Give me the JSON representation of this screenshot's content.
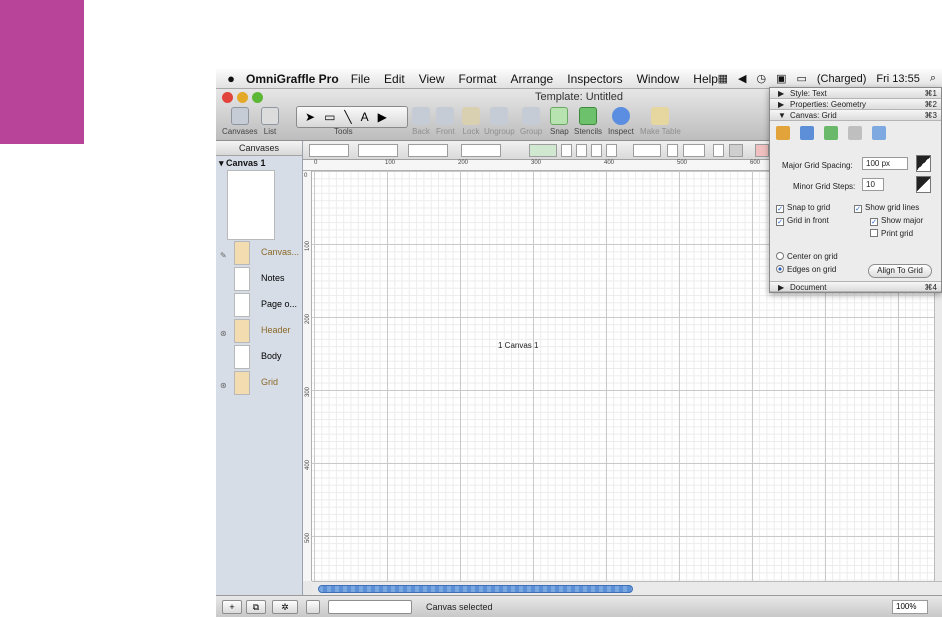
{
  "menubar": {
    "app_name": "OmniGraffle Pro",
    "items": [
      "File",
      "Edit",
      "View",
      "Format",
      "Arrange",
      "Inspectors",
      "Window",
      "Help"
    ],
    "battery": "(Charged)",
    "clock": "Fri 13:55"
  },
  "window": {
    "title": "Template: Untitled"
  },
  "toolbar": {
    "canvases_label": "Canvases",
    "list_label": "List",
    "tools_label": "Tools",
    "buttons": [
      "Back",
      "Front",
      "Lock",
      "Ungroup",
      "Group",
      "Snap",
      "Stencils",
      "Inspect",
      "Make Table"
    ]
  },
  "sidebar": {
    "header": "Canvases",
    "canvas_name": "▾ Canvas 1",
    "layers": [
      "Canvas...",
      "Notes",
      "Page o...",
      "Header",
      "Body",
      "Grid"
    ]
  },
  "ruler": {
    "top": [
      "0",
      "100",
      "200",
      "300",
      "400",
      "500",
      "600"
    ],
    "left": [
      "0",
      "100",
      "200",
      "300",
      "400",
      "500"
    ]
  },
  "canvas": {
    "label": "1 Canvas 1"
  },
  "status": {
    "text": "Canvas selected",
    "zoom": "100%"
  },
  "inspector": {
    "sections": [
      {
        "title": "Style: Text",
        "key": "⌘1"
      },
      {
        "title": "Properties: Geometry",
        "key": "⌘2"
      },
      {
        "title": "Canvas: Grid",
        "key": "⌘3"
      }
    ],
    "major_label": "Major Grid Spacing:",
    "major_value": "100 px",
    "minor_label": "Minor Grid Steps:",
    "minor_value": "10",
    "snap_to_grid": "Snap to grid",
    "show_grid_lines": "Show grid lines",
    "grid_in_front": "Grid in front",
    "show_major": "Show major",
    "print_grid": "Print grid",
    "center_on_grid": "Center on grid",
    "edges_on_grid": "Edges on grid",
    "align_button": "Align To Grid",
    "document_section": {
      "title": "Document",
      "key": "⌘4"
    }
  },
  "colors": {
    "accent": "#b8449a",
    "layer_swatch": "#f3dcb0",
    "selection": "#3f6fb8"
  }
}
